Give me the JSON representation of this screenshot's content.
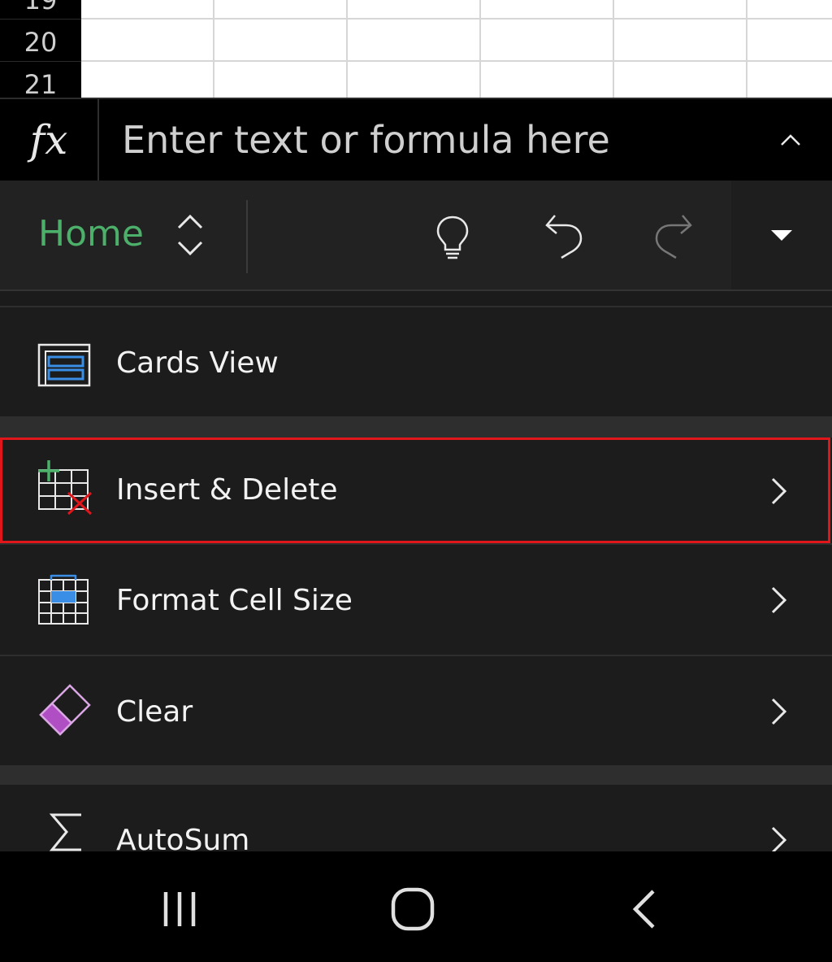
{
  "sheet": {
    "rows": [
      {
        "label": "19"
      },
      {
        "label": "20"
      },
      {
        "label": "21"
      }
    ]
  },
  "formula_bar": {
    "fx_label": "fx",
    "placeholder": "Enter text or formula here"
  },
  "toolbar": {
    "tab_label": "Home",
    "icons": [
      "lightbulb-icon",
      "undo-icon",
      "redo-icon",
      "dropdown-caret-icon"
    ]
  },
  "menu": {
    "items": [
      {
        "label": "Cards View",
        "icon": "cards-view-icon",
        "has_chevron": false
      },
      {
        "label": "Insert & Delete",
        "icon": "insert-delete-icon",
        "has_chevron": true,
        "highlighted": true
      },
      {
        "label": "Format Cell Size",
        "icon": "format-cell-size-icon",
        "has_chevron": true
      },
      {
        "label": "Clear",
        "icon": "eraser-icon",
        "has_chevron": true
      },
      {
        "label": "AutoSum",
        "icon": "sigma-icon",
        "has_chevron": true
      }
    ]
  },
  "colors": {
    "accent_green": "#4caf6a",
    "highlight_red": "#e0161b",
    "icon_blue": "#3a8ee6",
    "icon_purple": "#b04fc4"
  },
  "nav": {
    "icons": [
      "recent-apps-icon",
      "home-icon",
      "back-icon"
    ]
  }
}
